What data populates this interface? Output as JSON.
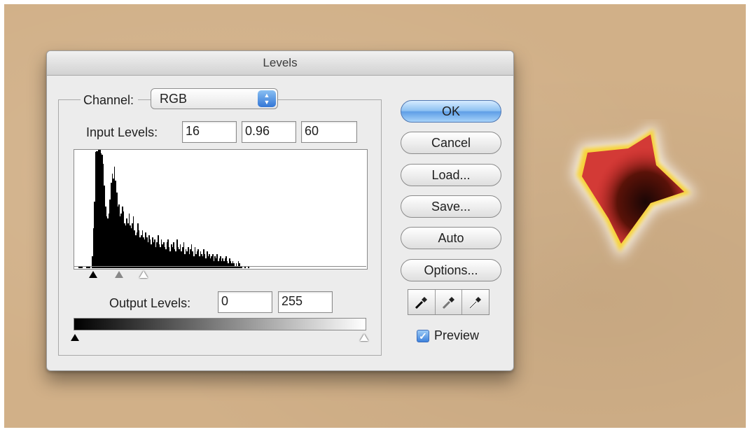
{
  "dialog": {
    "title": "Levels",
    "channel": {
      "label": "Channel:",
      "value": "RGB"
    },
    "input_levels": {
      "label": "Input Levels:",
      "black": "16",
      "gamma": "0.96",
      "white": "60"
    },
    "output_levels": {
      "label": "Output Levels:",
      "black": "0",
      "white": "255"
    },
    "buttons": {
      "ok": "OK",
      "cancel": "Cancel",
      "load": "Load...",
      "save": "Save...",
      "auto": "Auto",
      "options": "Options..."
    },
    "eyedroppers": [
      "black-eyedropper-icon",
      "gray-eyedropper-icon",
      "white-eyedropper-icon"
    ],
    "preview": {
      "label": "Preview",
      "checked": true
    }
  },
  "histogram": {
    "bins": [
      0,
      0,
      0,
      2,
      2,
      2,
      1,
      0,
      0,
      0,
      2,
      2,
      1,
      2,
      0,
      10,
      34,
      56,
      98,
      99,
      99,
      100,
      100,
      97,
      96,
      88,
      70,
      52,
      44,
      42,
      46,
      58,
      72,
      80,
      76,
      86,
      74,
      64,
      52,
      54,
      44,
      46,
      52,
      48,
      38,
      36,
      42,
      38,
      46,
      36,
      34,
      38,
      44,
      32,
      28,
      30,
      38,
      32,
      26,
      28,
      32,
      26,
      24,
      30,
      26,
      22,
      28,
      24,
      20,
      26,
      22,
      24,
      18,
      22,
      28,
      20,
      18,
      24,
      20,
      22,
      18,
      16,
      22,
      24,
      18,
      14,
      20,
      18,
      22,
      16,
      14,
      24,
      18,
      16,
      20,
      14,
      18,
      22,
      12,
      16,
      14,
      18,
      12,
      16,
      20,
      14,
      10,
      18,
      12,
      14,
      16,
      10,
      14,
      12,
      10,
      16,
      12,
      8,
      14,
      10,
      12,
      8,
      10,
      12,
      6,
      10,
      8,
      12,
      6,
      8,
      10,
      6,
      8,
      6,
      8,
      10,
      6,
      4,
      8,
      6,
      4,
      6,
      4,
      2,
      4,
      2,
      6,
      4,
      2,
      2,
      0,
      0,
      2,
      0,
      0,
      2,
      0,
      0,
      0,
      0,
      0,
      0,
      0,
      0,
      0,
      0,
      0,
      0,
      0,
      0,
      0,
      0,
      0,
      0,
      0,
      0,
      0,
      0,
      0,
      0,
      0,
      0,
      0,
      0,
      0,
      0,
      0,
      0,
      0,
      0,
      0,
      0,
      0,
      0,
      0,
      0,
      0,
      0,
      0,
      0,
      0,
      0,
      0,
      0,
      0,
      0,
      0,
      0,
      0,
      0,
      0,
      0,
      0,
      0,
      0,
      0,
      0,
      0,
      0,
      0,
      0,
      0,
      0,
      0,
      0,
      0,
      0,
      0,
      0,
      0,
      0,
      0,
      0,
      0,
      0,
      0,
      0,
      0,
      0,
      0,
      0,
      0,
      0,
      0,
      0,
      0,
      0,
      0,
      0,
      0,
      0,
      0,
      0,
      0,
      0,
      0,
      0,
      0,
      0,
      0,
      0
    ]
  },
  "colors": {
    "canvas_background": "#d1b088",
    "dialog_background": "#ececec",
    "accent_blue": "#5e9ee6"
  }
}
